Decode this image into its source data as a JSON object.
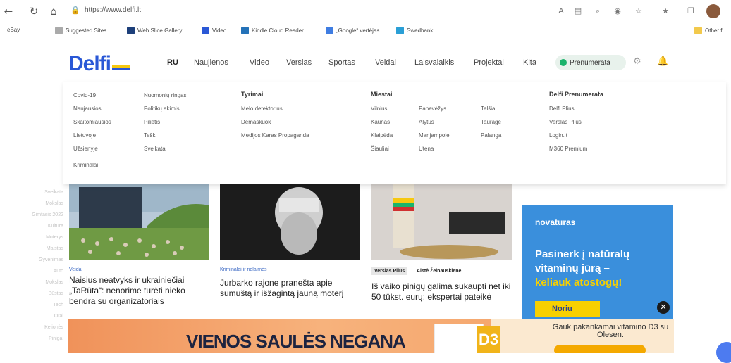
{
  "browser": {
    "url": "https://www.delfi.lt",
    "bookmarks": [
      "eBay",
      "Suggested Sites",
      "Web Slice Gallery",
      "Video",
      "Kindle Cloud Reader",
      "„Google“ vertėjas",
      "Swedbank",
      "Other f"
    ],
    "colors": {
      "accent": "#2a58d6"
    }
  },
  "site": {
    "logo_text": "Delfi",
    "nav": [
      "RU",
      "Naujienos",
      "Video",
      "Verslas",
      "Sportas",
      "Veidai",
      "Laisvalaikis",
      "Projektai",
      "Kita"
    ],
    "subscribe_label": "Prenumerata",
    "brand_colors": {
      "blue": "#2a58d6",
      "yellow": "#f6c80f",
      "green": "#1ab36b"
    }
  },
  "mega_menu": {
    "col1": [
      "Covid-19",
      "Naujausios",
      "Skaitomiausios",
      "Lietuvoje",
      "Užsienyje",
      "Kriminalai"
    ],
    "col2": [
      "Nuomonių ringas",
      "Politikų akimis",
      "Pilietis",
      "Tešk",
      "Sveikata"
    ],
    "tyrimai": {
      "title": "Tyrimai",
      "items": [
        "Melo detektorius",
        "Demaskuok",
        "Medijos Karas Propaganda"
      ]
    },
    "miestai": {
      "title": "Miestai",
      "items": [
        "Vilnius",
        "Panevėžys",
        "Telšiai",
        "Kaunas",
        "Alytus",
        "Tauragė",
        "Klaipėda",
        "Marijampolė",
        "Palanga",
        "Šiauliai",
        "Utena"
      ]
    },
    "prenumerata": {
      "title": "Delfi Prenumerata",
      "items": [
        "Delfi Plius",
        "Verslas Plius",
        "Login.lt",
        "M360 Premium"
      ]
    }
  },
  "articles": [
    {
      "category": "Veidai",
      "title": "Naisius neatvyks ir ukrainiečiai „TaRūta“: nenorime turėti nieko bendra su organizatoriais"
    },
    {
      "category": "Kriminalai ir nelaimės",
      "title": "Jurbarko rajone pranešta apie sumuštą ir išžagintą jauną moterį"
    },
    {
      "badge": "Verslas Plius",
      "author": "Aistė Želnauskienė",
      "title": "Iš vaiko pinigų galima sukaupti net iki 50 tūkst. eurų: ekspertai pateikė"
    }
  ],
  "ad": {
    "brand": "novaturas",
    "line1": "Pasinerk į natūralų",
    "line2": "vitaminų jūrą –",
    "line3": "keliauk atostogų!",
    "button": "Noriu"
  },
  "banner": {
    "headline": "VIENOS SAULĖS NEGANA",
    "right_text": "Gauk pakankamai vitamino D3 su Olesen.",
    "pkg_label": "D3"
  }
}
